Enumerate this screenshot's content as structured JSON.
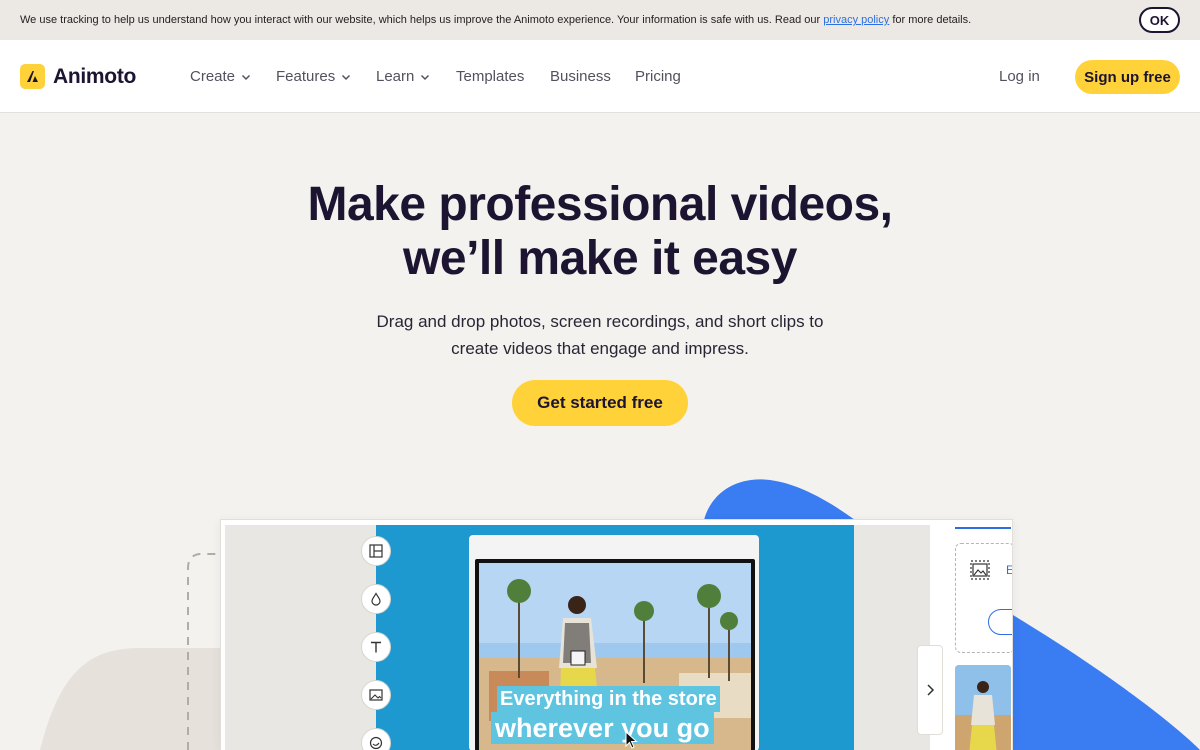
{
  "cookie": {
    "text_before": "We use tracking to help us understand how you interact with our website, which helps us improve the Animoto experience. Your information is safe with us. Read our ",
    "link_text": "privacy policy",
    "text_after": " for more details.",
    "ok_label": "OK"
  },
  "nav": {
    "brand": "Animoto",
    "items": [
      {
        "label": "Create",
        "has_dropdown": true
      },
      {
        "label": "Features",
        "has_dropdown": true
      },
      {
        "label": "Learn",
        "has_dropdown": true
      },
      {
        "label": "Templates",
        "has_dropdown": false
      },
      {
        "label": "Business",
        "has_dropdown": false
      },
      {
        "label": "Pricing",
        "has_dropdown": false
      }
    ],
    "login_label": "Log in",
    "signup_label": "Sign up free"
  },
  "hero": {
    "title_line1": "Make professional videos,",
    "title_line2": "we’ll make it easy",
    "subtitle_line1": "Drag and drop photos, screen recordings, and short clips to",
    "subtitle_line2": "create videos that engage and impress.",
    "cta_label": "Get started free"
  },
  "editor": {
    "caption_line1": "Everything in the store",
    "caption_line2": "wherever you go",
    "tools": [
      "layout-icon",
      "color-drop-icon",
      "text-icon",
      "image-icon",
      "sticker-icon"
    ],
    "upload_label": "E"
  },
  "colors": {
    "accent_yellow": "#ffd23a",
    "brand_dark": "#1c1430",
    "editor_blue": "#1d99d0",
    "deco_blue": "#3a7cf2",
    "link_blue": "#2d6fe0"
  }
}
